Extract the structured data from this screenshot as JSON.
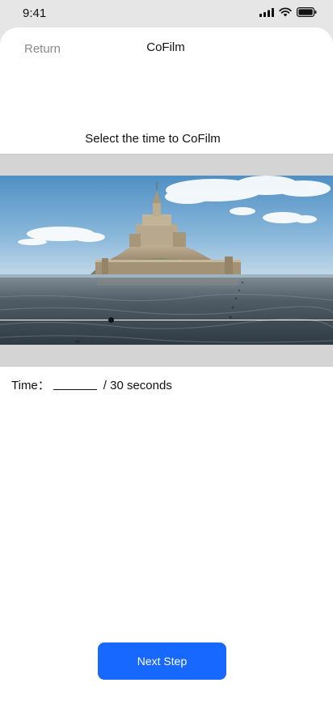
{
  "status_bar": {
    "time": "9:41"
  },
  "nav": {
    "return_label": "Return",
    "title": "CoFilm"
  },
  "instruction": "Select the time to CoFilm",
  "time_field": {
    "label": "Time：",
    "value": "",
    "suffix": "/ 30 seconds"
  },
  "actions": {
    "next_label": "Next Step"
  },
  "colors": {
    "accent": "#1668ff",
    "frame_gray": "#d4d4d4",
    "return_gray": "#8a8a8a"
  }
}
